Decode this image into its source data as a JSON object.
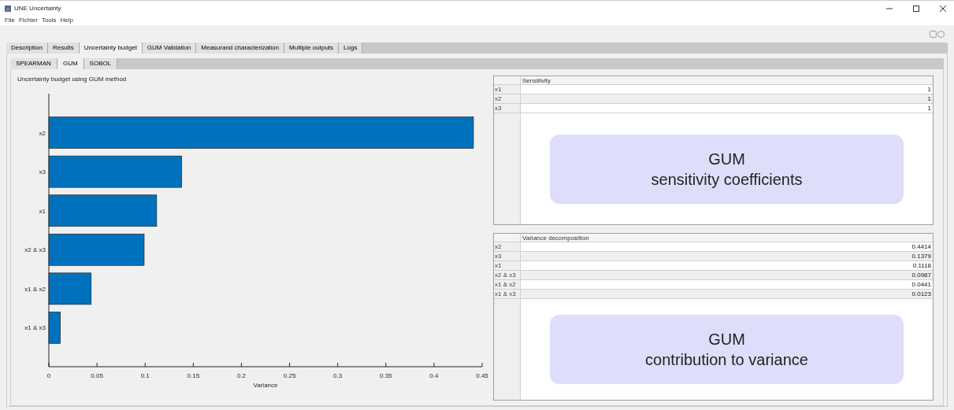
{
  "window": {
    "title": "UNE Uncertainty"
  },
  "menu": [
    "File",
    "Fichier",
    "Tools",
    "Help"
  ],
  "tabs": [
    {
      "label": "Description",
      "selected": false
    },
    {
      "label": "Results",
      "selected": false
    },
    {
      "label": "Uncertainty budget",
      "selected": true
    },
    {
      "label": "GUM Validation",
      "selected": false
    },
    {
      "label": "Measurand characterization",
      "selected": false
    },
    {
      "label": "Multiple outputs",
      "selected": false
    },
    {
      "label": "Logs",
      "selected": false
    }
  ],
  "subtabs": [
    {
      "label": "SPEARMAN",
      "selected": false
    },
    {
      "label": "GUM",
      "selected": true
    },
    {
      "label": "SOBOL",
      "selected": false
    }
  ],
  "chart_title": "Uncertainty budget using GUM method",
  "chart_data": {
    "type": "bar",
    "orientation": "horizontal",
    "xlabel": "Variance",
    "categories": [
      "x2",
      "x3",
      "x1",
      "x2 & x3",
      "x1 & x2",
      "x1 & x3"
    ],
    "series": [
      {
        "color": "#0072bd",
        "values": [
          0.441,
          0.138,
          0.112,
          0.099,
          0.044,
          0.012
        ]
      }
    ],
    "xlim": [
      0,
      0.45
    ],
    "xticks": [
      {
        "value": 0,
        "label": "0"
      },
      {
        "value": 0.05,
        "label": "0.05"
      },
      {
        "value": 0.1,
        "label": "0.1"
      },
      {
        "value": 0.15,
        "label": "0.15"
      },
      {
        "value": 0.2,
        "label": "0.2"
      },
      {
        "value": 0.25,
        "label": "0.25"
      },
      {
        "value": 0.3,
        "label": "0.3"
      },
      {
        "value": 0.35,
        "label": "0.35"
      },
      {
        "value": 0.4,
        "label": "0.4"
      },
      {
        "value": 0.45,
        "label": "0.45"
      }
    ]
  },
  "tables": [
    {
      "column": "Sensitivity",
      "rows": [
        {
          "name": "x1",
          "value": "1"
        },
        {
          "name": "x2",
          "value": "1"
        },
        {
          "name": "x3",
          "value": "1"
        }
      ],
      "callout": [
        "GUM",
        "sensitivity coefficients"
      ]
    },
    {
      "column": "Variance decomposition",
      "rows": [
        {
          "name": "x2",
          "value": "0.4414"
        },
        {
          "name": "x3",
          "value": "0.1379"
        },
        {
          "name": "x1",
          "value": "0.1118"
        },
        {
          "name": "x2 & x3",
          "value": "0.0987"
        },
        {
          "name": "x1 & x2",
          "value": "0.0441"
        },
        {
          "name": "x1 & x3",
          "value": "0.0123"
        }
      ],
      "callout": [
        "GUM",
        "contribution to variance"
      ]
    }
  ]
}
